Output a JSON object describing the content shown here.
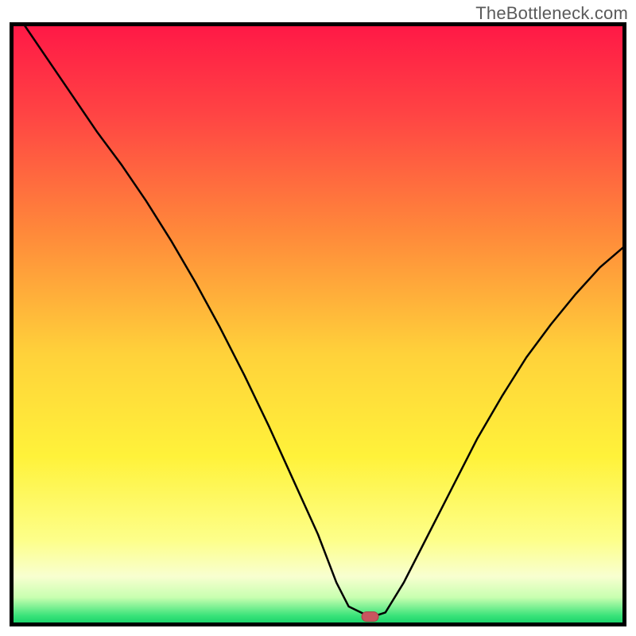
{
  "watermark": "TheBottleneck.com",
  "chart_data": {
    "type": "line",
    "title": "",
    "xlabel": "",
    "ylabel": "",
    "xlim": [
      0,
      100
    ],
    "ylim": [
      0,
      100
    ],
    "grid": false,
    "series": [
      {
        "name": "curve",
        "x": [
          2,
          6,
          10,
          14,
          18,
          22,
          26,
          30,
          34,
          38,
          42,
          46,
          50,
          53,
          55,
          58,
          59.5,
          61,
          64,
          68,
          72,
          76,
          80,
          84,
          88,
          92,
          96,
          100
        ],
        "y": [
          100,
          94,
          88,
          82,
          76.5,
          70.5,
          64,
          57,
          49.5,
          41.5,
          33,
          24,
          15,
          7,
          3,
          1.5,
          1.5,
          2,
          7,
          15,
          23,
          31,
          38,
          44.5,
          50,
          55,
          59.5,
          63
        ]
      }
    ],
    "marker": {
      "x": 58.5,
      "y": 1.3
    },
    "gradient_stops": [
      {
        "offset": 0.0,
        "color": "#ff1846"
      },
      {
        "offset": 0.15,
        "color": "#ff4444"
      },
      {
        "offset": 0.35,
        "color": "#ff8a3a"
      },
      {
        "offset": 0.55,
        "color": "#ffd23a"
      },
      {
        "offset": 0.72,
        "color": "#fff23a"
      },
      {
        "offset": 0.86,
        "color": "#fdff8a"
      },
      {
        "offset": 0.92,
        "color": "#f8ffd0"
      },
      {
        "offset": 0.955,
        "color": "#c8ffb0"
      },
      {
        "offset": 0.985,
        "color": "#3be37a"
      },
      {
        "offset": 1.0,
        "color": "#13d168"
      }
    ],
    "colors": {
      "border": "#000000",
      "curve": "#000000",
      "marker_fill": "#c9555f",
      "marker_stroke": "#a9404a"
    }
  }
}
